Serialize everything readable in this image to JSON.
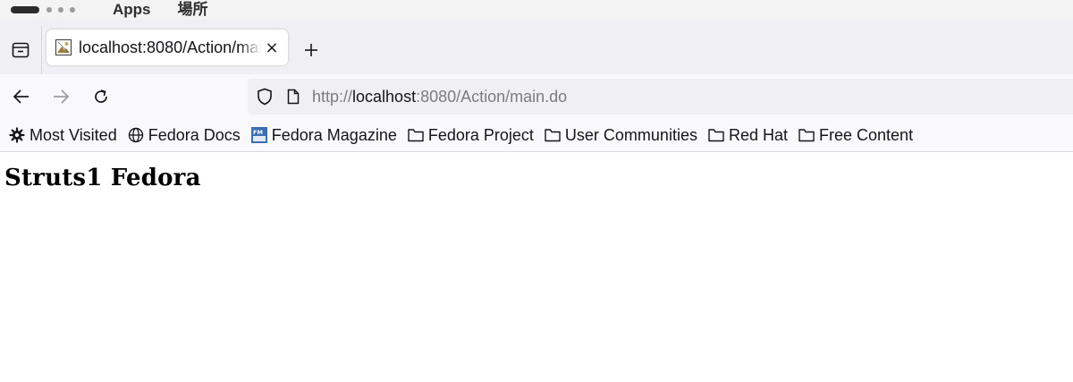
{
  "system_bar": {
    "menus": [
      "Apps",
      "場所"
    ]
  },
  "tab": {
    "title": "localhost:8080/Action/main.do",
    "close_label": "×"
  },
  "new_tab_label": "+",
  "urlbar": {
    "scheme": "http://",
    "host": "localhost",
    "rest": ":8080/Action/main.do"
  },
  "bookmarks": [
    {
      "label": "Most Visited",
      "icon": "gear-icon"
    },
    {
      "label": "Fedora Docs",
      "icon": "globe-icon"
    },
    {
      "label": "Fedora Magazine",
      "icon": "fedora-magazine-icon"
    },
    {
      "label": "Fedora Project",
      "icon": "folder-icon"
    },
    {
      "label": "User Communities",
      "icon": "folder-icon"
    },
    {
      "label": "Red Hat",
      "icon": "folder-icon"
    },
    {
      "label": "Free Content",
      "icon": "folder-icon"
    }
  ],
  "page": {
    "heading": "Struts1 Fedora"
  },
  "colors": {
    "tabstrip_bg": "#f0f0f4",
    "toolbar_bg": "#f9f9fb",
    "urlbar_bg": "#f0f0f4",
    "fedora_magazine_blue": "#3c6eb4"
  }
}
